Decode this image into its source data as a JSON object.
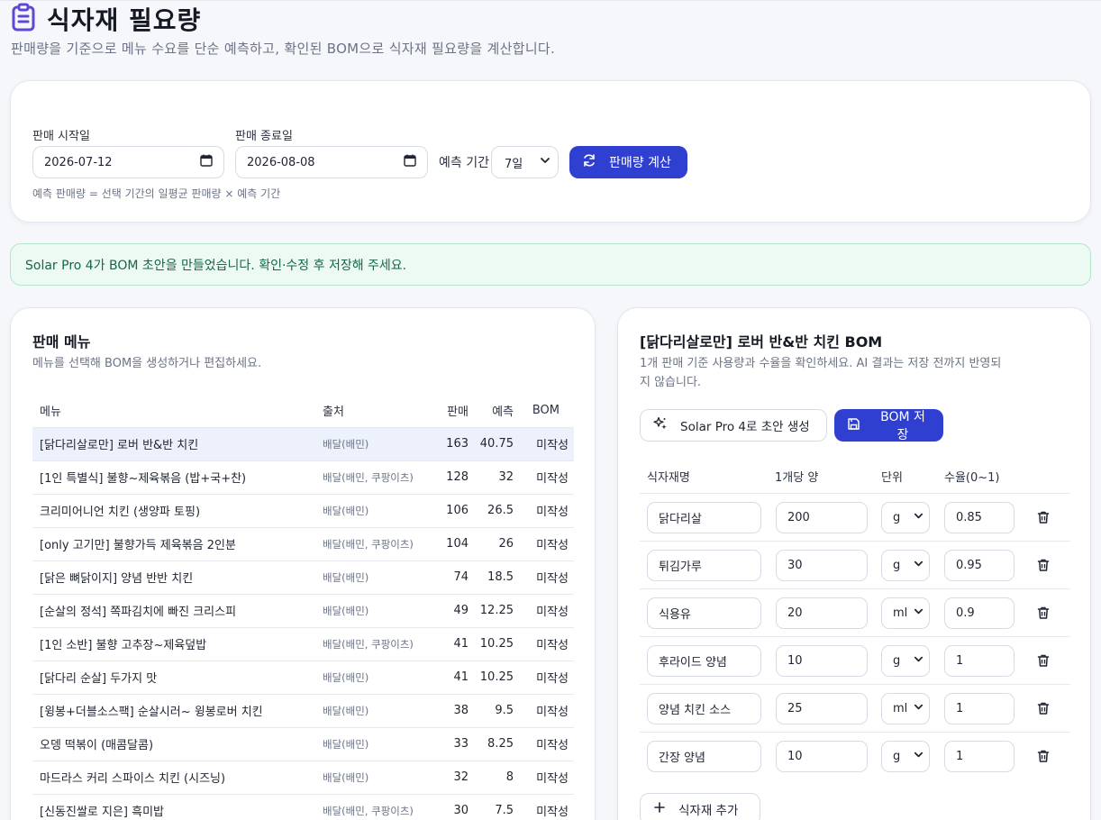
{
  "header": {
    "title": "식자재 필요량",
    "subtitle": "판매량을 기준으로 메뉴 수요를 단순 예측하고, 확인된 BOM으로 식자재 필요량을 계산합니다.",
    "icon": "clipboard-icon"
  },
  "filters": {
    "start_label": "판매 시작일",
    "start_value": "2026-07-12",
    "end_label": "판매 종료일",
    "end_value": "2026-08-08",
    "period_label": "예측 기간",
    "period_value": "7일",
    "calc_button": "판매량 계산",
    "hint": "예측 판매량 = 선택 기간의 일평균 판매량 × 예측 기간"
  },
  "alert": {
    "message": "Solar Pro 4가 BOM 초안을 만들었습니다. 확인·수정 후 저장해 주세요."
  },
  "menu_panel": {
    "title": "판매 메뉴",
    "description": "메뉴를 선택해 BOM을 생성하거나 편집하세요.",
    "columns": {
      "name": "메뉴",
      "source": "출처",
      "sales": "판매",
      "forecast": "예측",
      "bom": "BOM"
    },
    "rows": [
      {
        "name": "[닭다리살로만] 로버 반&반 치킨",
        "source": "배달(배민)",
        "sales": "163",
        "forecast": "40.75",
        "bom": "미작성",
        "selected": true
      },
      {
        "name": "[1인 특별식] 불향~제육볶음 (밥+국+찬)",
        "source": "배달(배민, 쿠팡이츠)",
        "sales": "128",
        "forecast": "32",
        "bom": "미작성"
      },
      {
        "name": "크리미어니언 치킨 (생양파 토핑)",
        "source": "배달(배민)",
        "sales": "106",
        "forecast": "26.5",
        "bom": "미작성"
      },
      {
        "name": "[only 고기만] 불향가득 제육볶음 2인분",
        "source": "배달(배민, 쿠팡이츠)",
        "sales": "104",
        "forecast": "26",
        "bom": "미작성"
      },
      {
        "name": "[닭은 뼈닭이지] 양념 반반 치킨",
        "source": "배달(배민)",
        "sales": "74",
        "forecast": "18.5",
        "bom": "미작성"
      },
      {
        "name": "[순살의 정석] 쪽파김치에 빠진 크리스피",
        "source": "배달(배민)",
        "sales": "49",
        "forecast": "12.25",
        "bom": "미작성"
      },
      {
        "name": "[1인 소반] 불향 고추장~제육덮밥",
        "source": "배달(배민, 쿠팡이츠)",
        "sales": "41",
        "forecast": "10.25",
        "bom": "미작성"
      },
      {
        "name": "[닭다리 순살] 두가지 맛",
        "source": "배달(배민)",
        "sales": "41",
        "forecast": "10.25",
        "bom": "미작성"
      },
      {
        "name": "[윙봉+더블소스팩] 순살시러~ 윙봉로버 치킨",
        "source": "배달(배민)",
        "sales": "38",
        "forecast": "9.5",
        "bom": "미작성"
      },
      {
        "name": "오뎅 떡볶이 (매콤달콤)",
        "source": "배달(배민)",
        "sales": "33",
        "forecast": "8.25",
        "bom": "미작성"
      },
      {
        "name": "마드라스 커리 스파이스 치킨 (시즈닝)",
        "source": "배달(배민)",
        "sales": "32",
        "forecast": "8",
        "bom": "미작성"
      },
      {
        "name": "[신동진쌀로 지은] 흑미밥",
        "source": "배달(배민, 쿠팡이츠)",
        "sales": "30",
        "forecast": "7.5",
        "bom": "미작성"
      }
    ]
  },
  "bom_panel": {
    "title": "[닭다리살로만] 로버 반&반 치킨 BOM",
    "description_line1": "1개 판매 기준 사용량과 수율을 확인하세요. AI 결과는 저장 전까지 반영되",
    "description_line2": "지 않습니다.",
    "generate_button": "Solar Pro 4로 초안 생성",
    "save_button": "BOM 저장",
    "columns": {
      "ingredient": "식자재명",
      "qty": "1개당 양",
      "unit": "단위",
      "yield": "수율(0~1)"
    },
    "rows": [
      {
        "ingredient": "닭다리살",
        "qty": "200",
        "unit": "g",
        "yield": "0.85"
      },
      {
        "ingredient": "튀김가루",
        "qty": "30",
        "unit": "g",
        "yield": "0.95"
      },
      {
        "ingredient": "식용유",
        "qty": "20",
        "unit": "ml",
        "yield": "0.9"
      },
      {
        "ingredient": "후라이드 양념",
        "qty": "10",
        "unit": "g",
        "yield": "1"
      },
      {
        "ingredient": "양념 치킨 소스",
        "qty": "25",
        "unit": "ml",
        "yield": "1"
      },
      {
        "ingredient": "간장 양념",
        "qty": "10",
        "unit": "g",
        "yield": "1"
      }
    ],
    "add_button": "식자재 추가"
  },
  "colors": {
    "accent": "#2f3fd0",
    "icon_accent": "#5b4ad6",
    "alert_bg": "#ecfaf3",
    "alert_text": "#17664a",
    "selected_row": "#edf1fc"
  }
}
